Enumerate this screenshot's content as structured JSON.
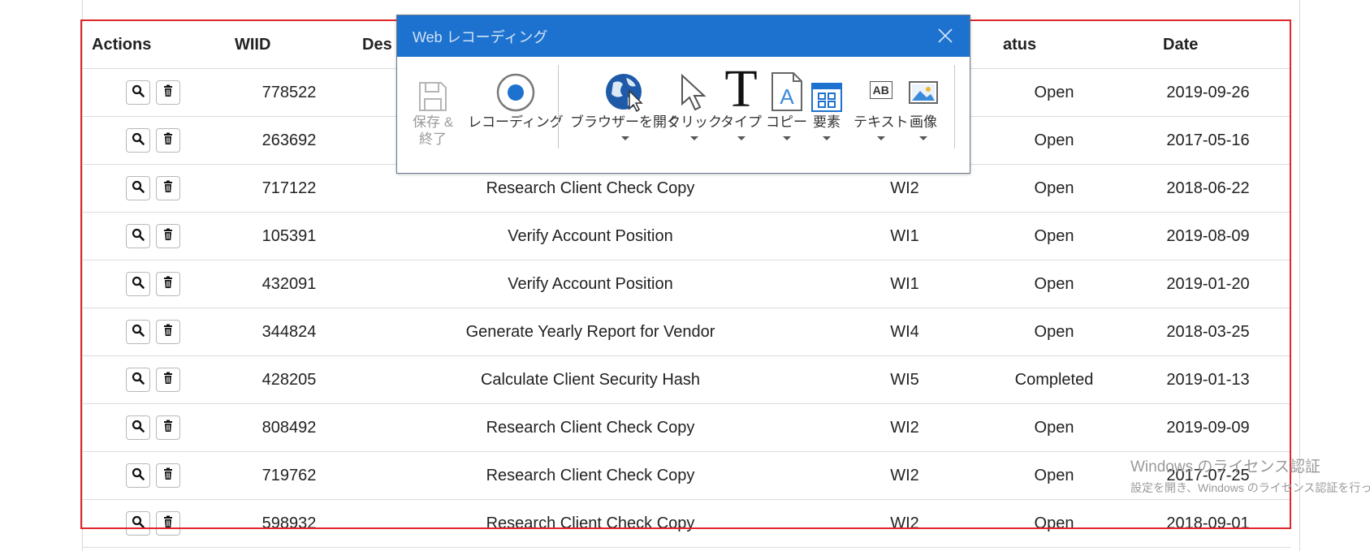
{
  "table": {
    "headers": {
      "actions": "Actions",
      "wiid": "WIID",
      "description": "Des",
      "wi": "",
      "status": "atus",
      "date": "Date"
    },
    "rows": [
      {
        "wiid": "778522",
        "description": "",
        "wi": "",
        "status": "Open",
        "date": "2019-09-26"
      },
      {
        "wiid": "263692",
        "description": "",
        "wi": "",
        "status": "Open",
        "date": "2017-05-16"
      },
      {
        "wiid": "717122",
        "description": "Research Client Check Copy",
        "wi": "WI2",
        "status": "Open",
        "date": "2018-06-22"
      },
      {
        "wiid": "105391",
        "description": "Verify Account Position",
        "wi": "WI1",
        "status": "Open",
        "date": "2019-08-09"
      },
      {
        "wiid": "432091",
        "description": "Verify Account Position",
        "wi": "WI1",
        "status": "Open",
        "date": "2019-01-20"
      },
      {
        "wiid": "344824",
        "description": "Generate Yearly Report for Vendor",
        "wi": "WI4",
        "status": "Open",
        "date": "2018-03-25"
      },
      {
        "wiid": "428205",
        "description": "Calculate Client Security Hash",
        "wi": "WI5",
        "status": "Completed",
        "date": "2019-01-13"
      },
      {
        "wiid": "808492",
        "description": "Research Client Check Copy",
        "wi": "WI2",
        "status": "Open",
        "date": "2019-09-09"
      },
      {
        "wiid": "719762",
        "description": "Research Client Check Copy",
        "wi": "WI2",
        "status": "Open",
        "date": "2017-07-25"
      },
      {
        "wiid": "598932",
        "description": "Research Client Check Copy",
        "wi": "WI2",
        "status": "Open",
        "date": "2018-09-01"
      }
    ],
    "row_icons": [
      "search-icon",
      "trash-icon"
    ]
  },
  "recorder": {
    "title": "Web レコーディング",
    "save_label_1": "保存 &",
    "save_label_2": "終了",
    "record_label": "レコーディング",
    "open_browser_label": "ブラウザーを開く",
    "click_label": "クリック",
    "type_label": "タイプ",
    "copy_label": "コピー",
    "element_label": "要素",
    "text_label": "テキスト",
    "image_label": "画像",
    "text_icon_glyph": "AB",
    "type_icon_glyph": "T",
    "copy_icon_glyph": "A"
  },
  "watermark": {
    "line1": "Windows のライセンス認証",
    "line2": "設定を開き、Windows のライセンス認証を行ってく"
  },
  "colors": {
    "accent": "#1e72cf",
    "highlight": "#e0262a"
  }
}
